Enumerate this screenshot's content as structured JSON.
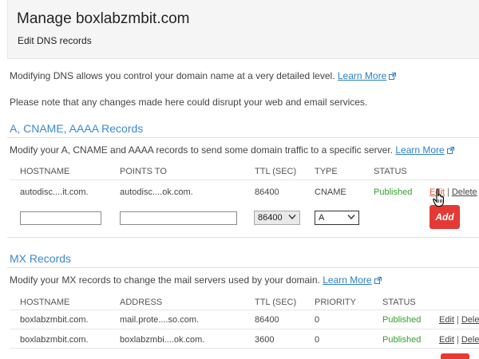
{
  "header": {
    "title": "Manage boxlabzmbit.com",
    "subtitle": "Edit DNS records"
  },
  "intro": {
    "line1_text": "Modifying DNS allows you control your domain name at a very detailed level.",
    "line1_link": "Learn More",
    "line2_text": "Please note that any changes made here could disrupt your web and email services."
  },
  "a_records": {
    "title": "A, CNAME, AAAA Records",
    "description": "Modify your A, CNAME and AAAA records to send some domain traffic to a specific server.",
    "learn_more": "Learn More",
    "columns": [
      "HOSTNAME",
      "POINTS TO",
      "TTL (SEC)",
      "TYPE",
      "STATUS"
    ],
    "rows": [
      {
        "hostname": "autodisc....it.com.",
        "points_to": "autodisc....ok.com.",
        "ttl": "86400",
        "type": "CNAME",
        "status": "Published",
        "edit": "Edit",
        "delete": "Delete"
      }
    ],
    "new_row": {
      "hostname_value": "",
      "points_to_value": "",
      "ttl_selected": "86400",
      "type_selected": "A",
      "add_label": "Add"
    }
  },
  "mx_records": {
    "title": "MX Records",
    "description": "Modify your MX records to change the mail servers used by your domain.",
    "learn_more": "Learn More",
    "columns": [
      "HOSTNAME",
      "ADDRESS",
      "TTL (SEC)",
      "PRIORITY",
      "STATUS"
    ],
    "rows": [
      {
        "hostname": "boxlabzmbit.com.",
        "address": "mail.prote....so.com.",
        "ttl": "86400",
        "priority": "0",
        "status": "Published",
        "edit": "Edit",
        "delete": "Delet"
      },
      {
        "hostname": "boxlabzmbit.com.",
        "address": "boxlabzmbi....ok.com.",
        "ttl": "3600",
        "priority": "0",
        "status": "Published",
        "edit": "Edit",
        "delete": "Delet"
      }
    ]
  },
  "colors": {
    "accent_link": "#2d7fc1",
    "section_title": "#3a8ad0",
    "status_published": "#33a02c",
    "add_button": "#e53935"
  },
  "icons": [
    "external-link-icon",
    "chevron-down-icon",
    "hand-pointer-icon"
  ]
}
